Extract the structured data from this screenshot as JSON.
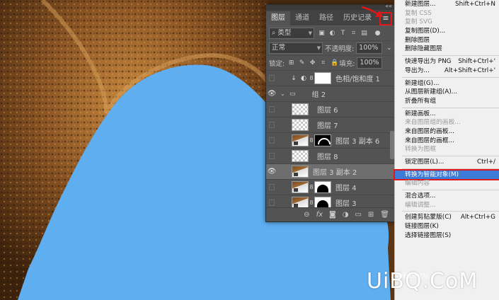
{
  "panel": {
    "tabs": [
      "图层",
      "通道",
      "路径",
      "历史记录"
    ],
    "menu_icon": "hamburger-icon",
    "filter_kind": "类型",
    "blend_mode": "正常",
    "opacity_label": "不透明度:",
    "opacity_value": "100%",
    "lock_label": "锁定:",
    "fill_label": "填充:",
    "fill_value": "100%",
    "layers": [
      {
        "name": "色相/饱和度 1",
        "visible": false,
        "type": "adjustment"
      },
      {
        "name": "组 2",
        "visible": true,
        "type": "group"
      },
      {
        "name": "图层 6",
        "visible": false,
        "type": "plain"
      },
      {
        "name": "图层 7",
        "visible": false,
        "type": "plain"
      },
      {
        "name": "图层 3 副本 6",
        "visible": false,
        "type": "masked-black"
      },
      {
        "name": "图层 8",
        "visible": false,
        "type": "plain"
      },
      {
        "name": "图层 3 副本 2",
        "visible": true,
        "type": "image",
        "selected": true
      },
      {
        "name": "图层 4",
        "visible": false,
        "type": "masked-white"
      },
      {
        "name": "图层 3",
        "visible": false,
        "type": "masked-white"
      }
    ]
  },
  "menu": {
    "items": [
      {
        "label": "新建图层...",
        "shortcut": "Shift+Ctrl+N"
      },
      {
        "label": "复制 CSS",
        "disabled": true
      },
      {
        "label": "复制 SVG",
        "disabled": true
      },
      {
        "label": "复制图层(D)..."
      },
      {
        "label": "删除图层"
      },
      {
        "label": "删除隐藏图层",
        "sep_after": true
      },
      {
        "label": "快速导出为 PNG",
        "shortcut": "Shift+Ctrl+'"
      },
      {
        "label": "导出为...",
        "shortcut": "Alt+Shift+Ctrl+'",
        "sep_after": true
      },
      {
        "label": "新建组(G)..."
      },
      {
        "label": "从图层新建组(A)..."
      },
      {
        "label": "折叠所有组",
        "sep_after": true
      },
      {
        "label": "新建画板..."
      },
      {
        "label": "来自图层组的画板...",
        "disabled": true
      },
      {
        "label": "来自图层的画板..."
      },
      {
        "label": "来自图层的画框..."
      },
      {
        "label": "转换为图框",
        "disabled": true,
        "sep_after": true
      },
      {
        "label": "锁定图层(L)...",
        "shortcut": "Ctrl+/",
        "sep_after": true
      },
      {
        "label": "转换为智能对象(M)",
        "highlighted": true
      },
      {
        "label": "编辑内容",
        "disabled": true,
        "sep_after": true
      },
      {
        "label": "混合选项..."
      },
      {
        "label": "编辑调整...",
        "disabled": true,
        "sep_after": true
      },
      {
        "label": "创建剪贴蒙版(C)",
        "shortcut": "Alt+Ctrl+G"
      },
      {
        "label": "链接图层(K)"
      },
      {
        "label": "选择链接图层(S)"
      }
    ]
  },
  "watermark": {
    "text": "UiBQ.CoM",
    "subtext": "思缘设计论坛"
  },
  "colors": {
    "sky": "#5eaef0",
    "highlight": "#3c7bd6",
    "annotation": "#e01818"
  }
}
